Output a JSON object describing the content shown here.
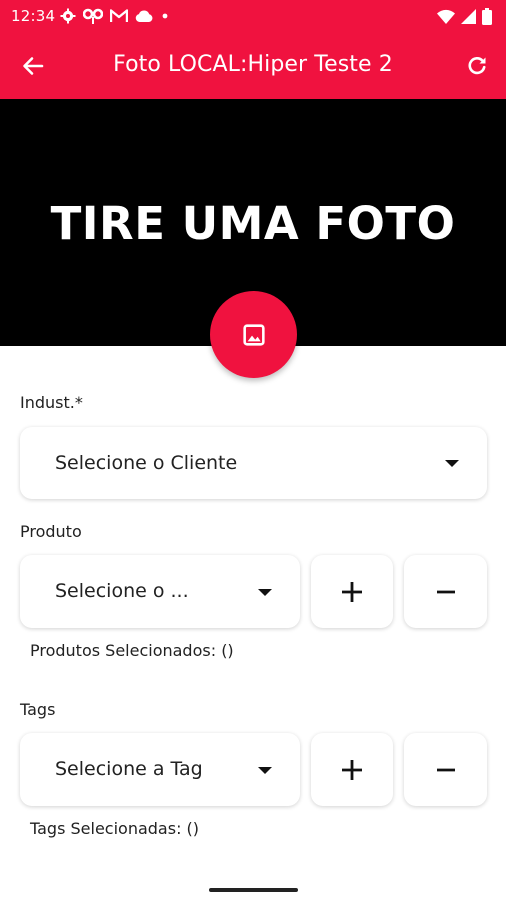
{
  "status_bar": {
    "time": "12:34",
    "icons_left": [
      "settings-icon",
      "network-icon",
      "gmail-icon",
      "cloud-icon",
      "dot-icon"
    ],
    "icons_right": [
      "wifi-icon",
      "signal-icon",
      "battery-icon"
    ]
  },
  "app_bar": {
    "title": "Foto LOCAL:Hiper Teste 2",
    "back_icon": "arrow-back-icon",
    "refresh_icon": "refresh-icon"
  },
  "photo": {
    "placeholder": "TIRE UMA FOTO",
    "fab_icon": "image-icon"
  },
  "form": {
    "industry": {
      "label": "Indust.*",
      "value": "Selecione o Cliente"
    },
    "product": {
      "label": "Produto",
      "value": "Selecione o ...",
      "add_label": "+",
      "remove_label": "−",
      "selected": "Produtos Selecionados: ()"
    },
    "tags": {
      "label": "Tags",
      "value": "Selecione a Tag",
      "add_label": "+",
      "remove_label": "−",
      "selected": "Tags Selecionadas: ()"
    }
  },
  "colors": {
    "primary": "#f0123f",
    "photo_background": "#000000",
    "surface": "#ffffff"
  }
}
